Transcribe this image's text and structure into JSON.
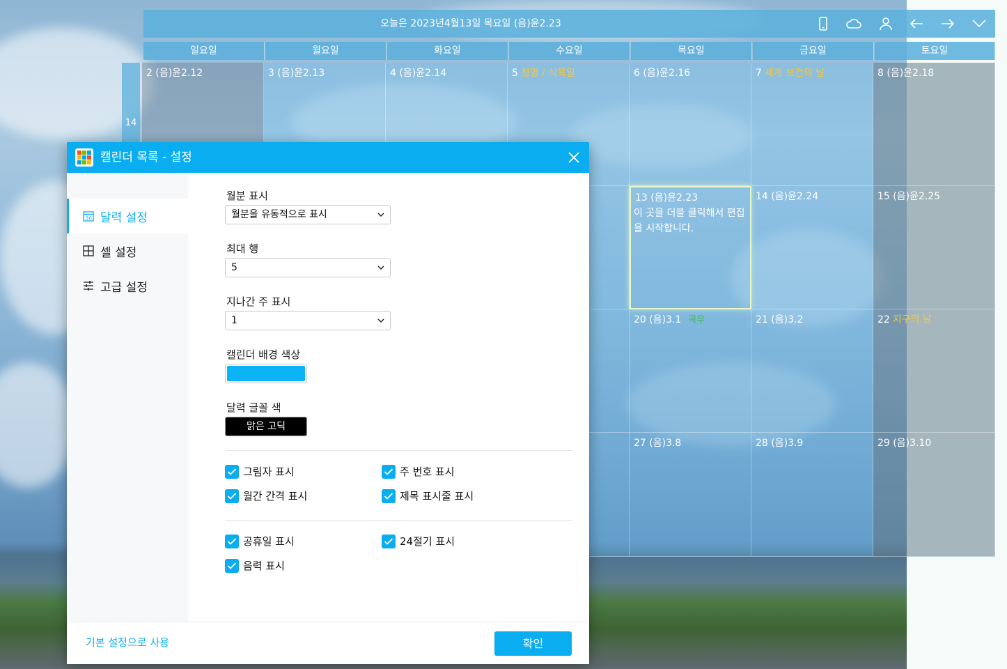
{
  "calendar": {
    "today_text": "오늘은 2023년4월13일 목요일 (음)윤2.23",
    "weekdays": [
      "일요일",
      "월요일",
      "화요일",
      "수요일",
      "목요일",
      "금요일",
      "토요일"
    ],
    "week_numbers": [
      "14"
    ],
    "cells": {
      "r0c0": {
        "date": "2  (음)윤2.12"
      },
      "r0c1": {
        "date": "3  (음)윤2.13"
      },
      "r0c2": {
        "date": "4  (음)윤2.14"
      },
      "r0c3": {
        "date": "5",
        "holiday": "청명 / 식목일"
      },
      "r0c4": {
        "date": "6  (음)윤2.16"
      },
      "r0c5": {
        "date": "7",
        "holiday": "세계 보건의 날"
      },
      "r0c6": {
        "date": "8  (음)윤2.18"
      },
      "r1c4": {
        "date": "13  (음)윤2.23",
        "note": "이 곳을 더블 클릭해서 편집을 시작합니다."
      },
      "r1c5": {
        "date": "14  (음)윤2.24"
      },
      "r1c6": {
        "date": "15  (음)윤2.25"
      },
      "r2c4": {
        "date": "20  (음)3.1",
        "term": "곡우"
      },
      "r2c5": {
        "date": "21  (음)3.2"
      },
      "r2c6": {
        "date": "22",
        "holiday": "지구의 날"
      },
      "r3c4": {
        "date": "27  (음)3.8"
      },
      "r3c5": {
        "date": "28  (음)3.9"
      },
      "r3c6": {
        "date": "29  (음)3.10"
      }
    },
    "header_icons": [
      "phone-icon",
      "cloud-icon",
      "user-icon",
      "arrow-left-icon",
      "arrow-right-icon",
      "chevron-down-icon"
    ]
  },
  "dialog": {
    "title": "캘린더 목록 - 설정",
    "sidebar": [
      {
        "label": "달력 설정",
        "icon": "calendar-icon",
        "active": true
      },
      {
        "label": "셀 설정",
        "icon": "grid-icon",
        "active": false
      },
      {
        "label": "고급 설정",
        "icon": "sliders-icon",
        "active": false
      }
    ],
    "fields": {
      "month_display": {
        "label": "월분 표시",
        "value": "월분을 유동적으로 표시"
      },
      "max_rows": {
        "label": "최대 행",
        "value": "5"
      },
      "past_weeks": {
        "label": "지나간 주 표시",
        "value": "1"
      },
      "bg_color": {
        "label": "캘린더 배경 색상",
        "color": "#0ab4f5"
      },
      "font_color": {
        "label": "달력 글꼴 색",
        "value": "맑은 고딕"
      }
    },
    "checkboxes": {
      "shadow": {
        "label": "그림자 표시",
        "checked": true
      },
      "week_number": {
        "label": "주 번호 표시",
        "checked": true
      },
      "month_gap": {
        "label": "월간 간격 표시",
        "checked": true
      },
      "title_bar": {
        "label": "제목 표시줄 표시",
        "checked": true
      },
      "holidays": {
        "label": "공휴일 표시",
        "checked": true
      },
      "solar_terms": {
        "label": "24절기 표시",
        "checked": true
      },
      "lunar": {
        "label": "음력 표시",
        "checked": true
      }
    },
    "footer": {
      "reset_label": "기본 설정으로 사용",
      "ok_label": "확인"
    }
  },
  "colors": {
    "accent": "#0aaef0",
    "holiday": "#f5c842",
    "solar_term": "#3fb950"
  }
}
